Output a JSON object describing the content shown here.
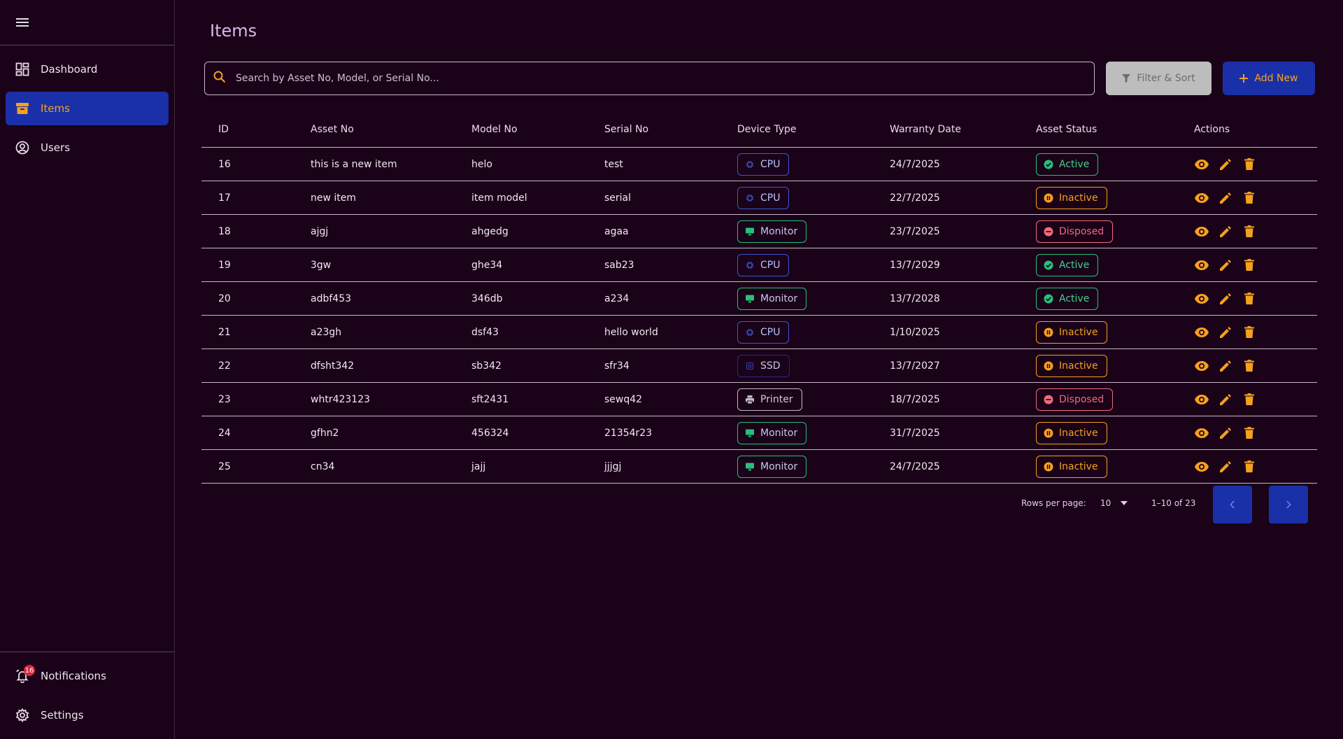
{
  "sidebar": {
    "nav": [
      {
        "label": "Dashboard",
        "icon": "dashboard-icon"
      },
      {
        "label": "Items",
        "icon": "archive-icon"
      },
      {
        "label": "Users",
        "icon": "account-circle-icon"
      }
    ],
    "bottom": [
      {
        "label": "Notifications",
        "icon": "bell-icon",
        "badge": "16"
      },
      {
        "label": "Settings",
        "icon": "gear-icon"
      }
    ]
  },
  "page": {
    "title": "Items"
  },
  "search": {
    "placeholder": "Search by Asset No, Model, or Serial No...",
    "value": ""
  },
  "toolbar": {
    "filter_label": "Filter & Sort",
    "add_label": "Add New"
  },
  "table": {
    "headers": [
      "ID",
      "Asset No",
      "Model No",
      "Serial No",
      "Device Type",
      "Warranty Date",
      "Asset Status",
      "Actions"
    ],
    "rows": [
      {
        "id": "16",
        "asset": "this is a new item",
        "model": "helo",
        "serial": "test",
        "device": "CPU",
        "warranty": "24/7/2025",
        "status": "Active"
      },
      {
        "id": "17",
        "asset": "new item",
        "model": "item model",
        "serial": "serial",
        "device": "CPU",
        "warranty": "22/7/2025",
        "status": "Inactive"
      },
      {
        "id": "18",
        "asset": "ajgj",
        "model": "ahgedg",
        "serial": "agaa",
        "device": "Monitor",
        "warranty": "23/7/2025",
        "status": "Disposed"
      },
      {
        "id": "19",
        "asset": "3gw",
        "model": "ghe34",
        "serial": "sab23",
        "device": "CPU",
        "warranty": "13/7/2029",
        "status": "Active"
      },
      {
        "id": "20",
        "asset": "adbf453",
        "model": "346db",
        "serial": "a234",
        "device": "Monitor",
        "warranty": "13/7/2028",
        "status": "Active"
      },
      {
        "id": "21",
        "asset": "a23gh",
        "model": "dsf43",
        "serial": "hello world",
        "device": "CPU",
        "warranty": "1/10/2025",
        "status": "Inactive"
      },
      {
        "id": "22",
        "asset": "dfsht342",
        "model": "sb342",
        "serial": "sfr34",
        "device": "SSD",
        "warranty": "13/7/2027",
        "status": "Inactive"
      },
      {
        "id": "23",
        "asset": "whtr423123",
        "model": "sft2431",
        "serial": "sewq42",
        "device": "Printer",
        "warranty": "18/7/2025",
        "status": "Disposed"
      },
      {
        "id": "24",
        "asset": "gfhn2",
        "model": "456324",
        "serial": "21354r23",
        "device": "Monitor",
        "warranty": "31/7/2025",
        "status": "Inactive"
      },
      {
        "id": "25",
        "asset": "cn34",
        "model": "jajj",
        "serial": "jjjgj",
        "device": "Monitor",
        "warranty": "24/7/2025",
        "status": "Inactive"
      }
    ]
  },
  "pagination": {
    "rows_label": "Rows per page:",
    "rows_value": "10",
    "range": "1–10 of 23"
  },
  "colors": {
    "accent": "#f5a01e",
    "primary": "#1a30a8",
    "background": "#1a0218",
    "active": "#27c07a",
    "disposed": "#ef6b7d"
  }
}
